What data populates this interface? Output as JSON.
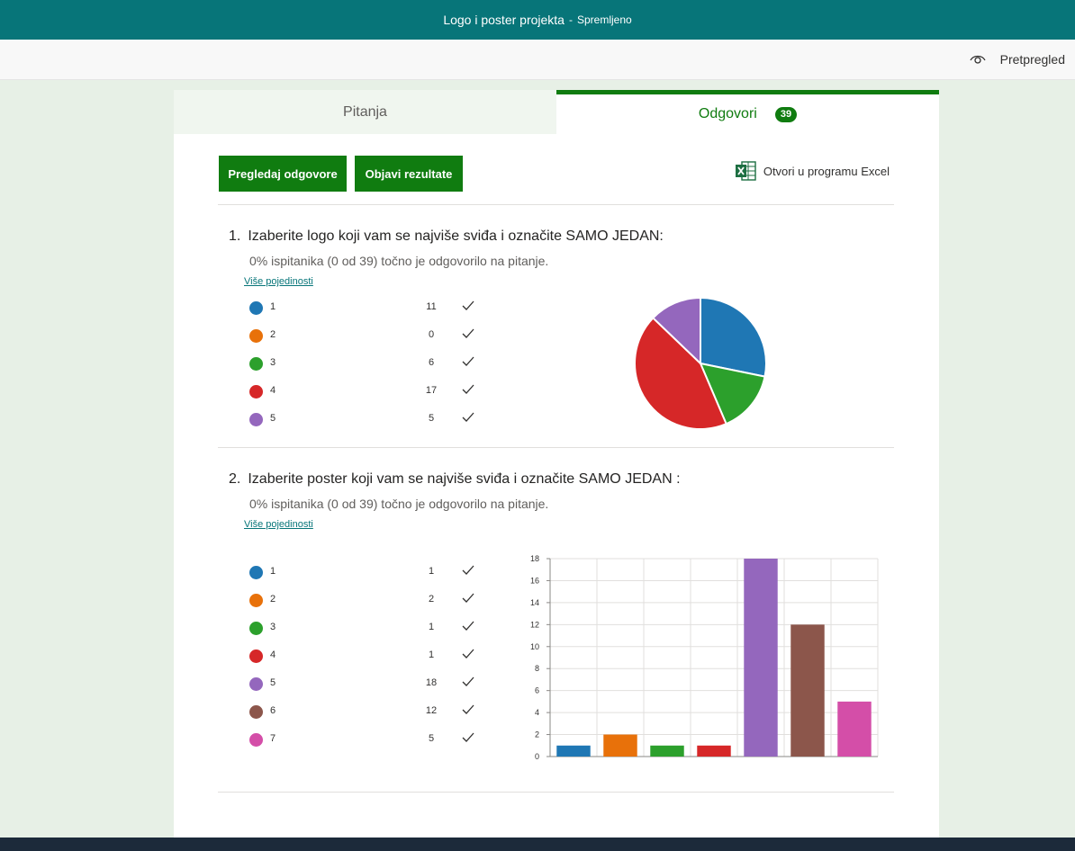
{
  "window": {
    "title": "Logo i poster projekta",
    "separator": "-",
    "status": "Spremljeno"
  },
  "commandbar": {
    "preview_label": "Pretpregled"
  },
  "tabs": {
    "questions": "Pitanja",
    "responses": "Odgovori",
    "responses_count": "39"
  },
  "actions": {
    "view_responses": "Pregledaj odgovore",
    "publish_results": "Objavi rezultate",
    "open_excel": "Otvori u programu Excel"
  },
  "colors": {
    "accent": "#107c10",
    "teal": "#077579"
  },
  "questions": [
    {
      "number": "1.",
      "title": "Izaberite logo koji vam se najviše sviđa i označite SAMO JEDAN:",
      "summary": "0% ispitanika (0 od 39) točno je odgovorilo na pitanje.",
      "more_details": "Više pojedinosti",
      "options": [
        {
          "label": "1",
          "count": "11",
          "color": "#1f77b4"
        },
        {
          "label": "2",
          "count": "0",
          "color": "#e8710a"
        },
        {
          "label": "3",
          "count": "6",
          "color": "#2ca02c"
        },
        {
          "label": "4",
          "count": "17",
          "color": "#d62728"
        },
        {
          "label": "5",
          "count": "5",
          "color": "#9467bd"
        }
      ]
    },
    {
      "number": "2.",
      "title": "Izaberite poster koji vam se najviše sviđa i označite SAMO JEDAN :",
      "summary": "0% ispitanika (0 od 39) točno je odgovorilo na pitanje.",
      "more_details": "Više pojedinosti",
      "options": [
        {
          "label": "1",
          "count": "1",
          "color": "#1f77b4"
        },
        {
          "label": "2",
          "count": "2",
          "color": "#e8710a"
        },
        {
          "label": "3",
          "count": "1",
          "color": "#2ca02c"
        },
        {
          "label": "4",
          "count": "1",
          "color": "#d62728"
        },
        {
          "label": "5",
          "count": "18",
          "color": "#9467bd"
        },
        {
          "label": "6",
          "count": "12",
          "color": "#8c564b"
        },
        {
          "label": "7",
          "count": "5",
          "color": "#d44ea8"
        }
      ]
    }
  ],
  "chart_data": [
    {
      "type": "pie",
      "categories": [
        "1",
        "2",
        "3",
        "4",
        "5"
      ],
      "values": [
        11,
        0,
        6,
        17,
        5
      ],
      "colors": [
        "#1f77b4",
        "#e8710a",
        "#2ca02c",
        "#d62728",
        "#9467bd"
      ]
    },
    {
      "type": "bar",
      "categories": [
        "1",
        "2",
        "3",
        "4",
        "5",
        "6",
        "7"
      ],
      "values": [
        1,
        2,
        1,
        1,
        18,
        12,
        5
      ],
      "colors": [
        "#1f77b4",
        "#e8710a",
        "#2ca02c",
        "#d62728",
        "#9467bd",
        "#8c564b",
        "#d44ea8"
      ],
      "ylim": [
        0,
        18
      ],
      "yticks": [
        "0",
        "2",
        "4",
        "6",
        "8",
        "10",
        "12",
        "14",
        "16",
        "18"
      ],
      "grid": true
    }
  ]
}
